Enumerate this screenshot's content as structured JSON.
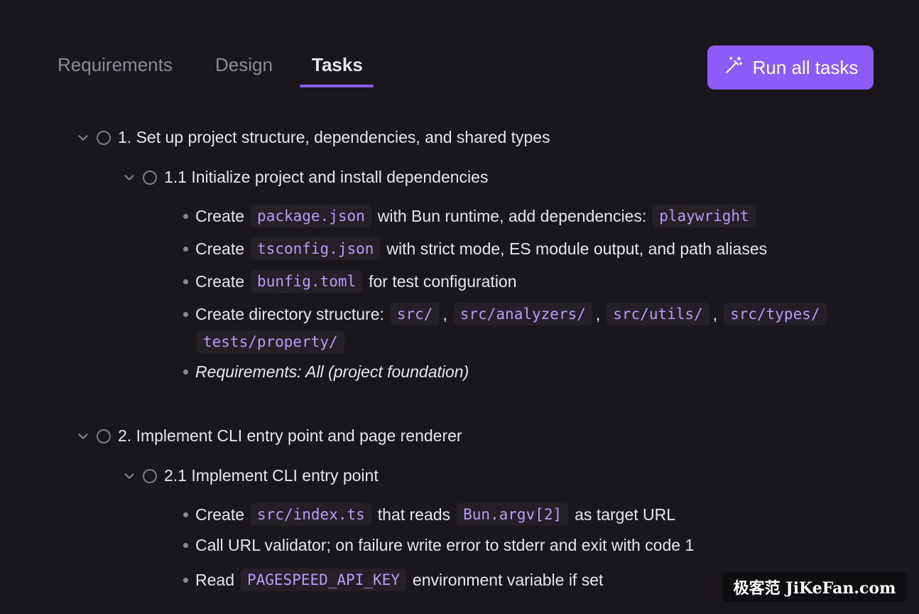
{
  "tabs": [
    {
      "label": "Requirements",
      "active": false
    },
    {
      "label": "Design",
      "active": false
    },
    {
      "label": "Tasks",
      "active": true
    }
  ],
  "run_button": {
    "label": "Run all tasks",
    "icon": "magic-wand-icon"
  },
  "accent_color": "#8b5cf6",
  "tasks": [
    {
      "label": "1. Set up project structure, dependencies, and shared types",
      "subtasks": [
        {
          "label": "1.1 Initialize project and install dependencies",
          "bullets": [
            {
              "parts": [
                "Create",
                "package.json",
                "with Bun runtime, add dependencies:",
                "playwright"
              ]
            },
            {
              "parts": [
                "Create",
                "tsconfig.json",
                "with strict mode, ES module output, and path aliases"
              ]
            },
            {
              "parts": [
                "Create",
                "bunfig.toml",
                "for test configuration"
              ]
            },
            {
              "parts": [
                "Create directory structure:",
                "src/",
                ",",
                "src/analyzers/",
                ",",
                "src/utils/",
                ",",
                "src/types/",
                "tests/property/"
              ]
            },
            {
              "parts": [
                "Requirements: All (project foundation)"
              ]
            }
          ]
        }
      ]
    },
    {
      "label": "2. Implement CLI entry point and page renderer",
      "subtasks": [
        {
          "label": "2.1 Implement CLI entry point",
          "bullets": [
            {
              "parts": [
                "Create",
                "src/index.ts",
                "that reads",
                "Bun.argv[2]",
                "as target URL"
              ]
            },
            {
              "parts": [
                "Call URL validator; on failure write error to stderr and exit with code 1"
              ]
            },
            {
              "parts": [
                "Read",
                "PAGESPEED_API_KEY",
                "environment variable if set"
              ]
            }
          ]
        }
      ]
    }
  ],
  "watermark": "极客范 JiKeFan.com"
}
